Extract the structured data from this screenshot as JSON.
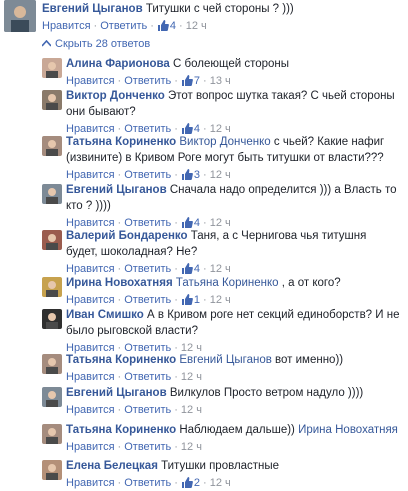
{
  "root_comment": {
    "author": "Евгений Цыганов",
    "text": "Титушки с чей стороны ? )))",
    "like": "Нравится",
    "reply": "Ответить",
    "likes": "4",
    "time": "12 ч"
  },
  "collapse_label": "Скрыть 28 ответов",
  "colors": {
    "link": "#365899",
    "meta": "#90949c",
    "action": "#4267b2"
  },
  "replies": [
    {
      "author": "Алина Фарионова",
      "mention": "",
      "text": "С болеющей стороны",
      "like": "Нравится",
      "reply": "Ответить",
      "likes": "7",
      "time": "13 ч"
    },
    {
      "author": "Виктор Донченко",
      "mention": "",
      "text": "Этот вопрос шутка такая? С чьей стороны они бывают?",
      "like": "Нравится",
      "reply": "Ответить",
      "likes": "4",
      "time": "12 ч"
    },
    {
      "author": "Татьяна Кориненко",
      "mention": "Виктор Донченко",
      "text": "с чьей? Какие нафиг (извините) в Кривом Роге могут быть титушки от власти???",
      "like": "Нравится",
      "reply": "Ответить",
      "likes": "3",
      "time": "12 ч"
    },
    {
      "author": "Евгений Цыганов",
      "mention": "",
      "text": "Сначала надо определится ))) а Власть то кто ? ))))",
      "like": "Нравится",
      "reply": "Ответить",
      "likes": "4",
      "time": "12 ч"
    },
    {
      "author": "Валерий Бондаренко",
      "mention": "",
      "text": "Таня, а с Чернигова чья титушня будет, шоколадная? Не?",
      "like": "Нравится",
      "reply": "Ответить",
      "likes": "4",
      "time": "12 ч"
    },
    {
      "author": "Ирина Новохатняя",
      "mention": "Татьяна Кориненко",
      "text": ", а от кого?",
      "like": "Нравится",
      "reply": "Ответить",
      "likes": "1",
      "time": "12 ч"
    },
    {
      "author": "Иван Смишко",
      "mention": "",
      "text": "А в Кривом роге нет секций единоборств? И не было рыговской власти?",
      "like": "Нравится",
      "reply": "Ответить",
      "likes": "",
      "time": "12 ч"
    },
    {
      "author": "Татьяна Кориненко",
      "mention": "Евгений Цыганов",
      "text": "вот именно))",
      "like": "Нравится",
      "reply": "Ответить",
      "likes": "",
      "time": "12 ч"
    },
    {
      "author": "Евгений Цыганов",
      "mention": "",
      "text": "Вилкулов Просто ветром надуло ))))",
      "like": "Нравится",
      "reply": "Ответить",
      "likes": "",
      "time": "12 ч"
    },
    {
      "author": "Татьяна Кориненко",
      "mention": "",
      "text": "Наблюдаем дальше)) ",
      "mention_after": "Ирина Новохатняя",
      "like": "Нравится",
      "reply": "Ответить",
      "likes": "",
      "time": "12 ч"
    },
    {
      "author": "Елена Белецкая",
      "mention": "",
      "text": "Титушки провластные",
      "like": "Нравится",
      "reply": "Ответить",
      "likes": "2",
      "time": "12 ч"
    }
  ]
}
